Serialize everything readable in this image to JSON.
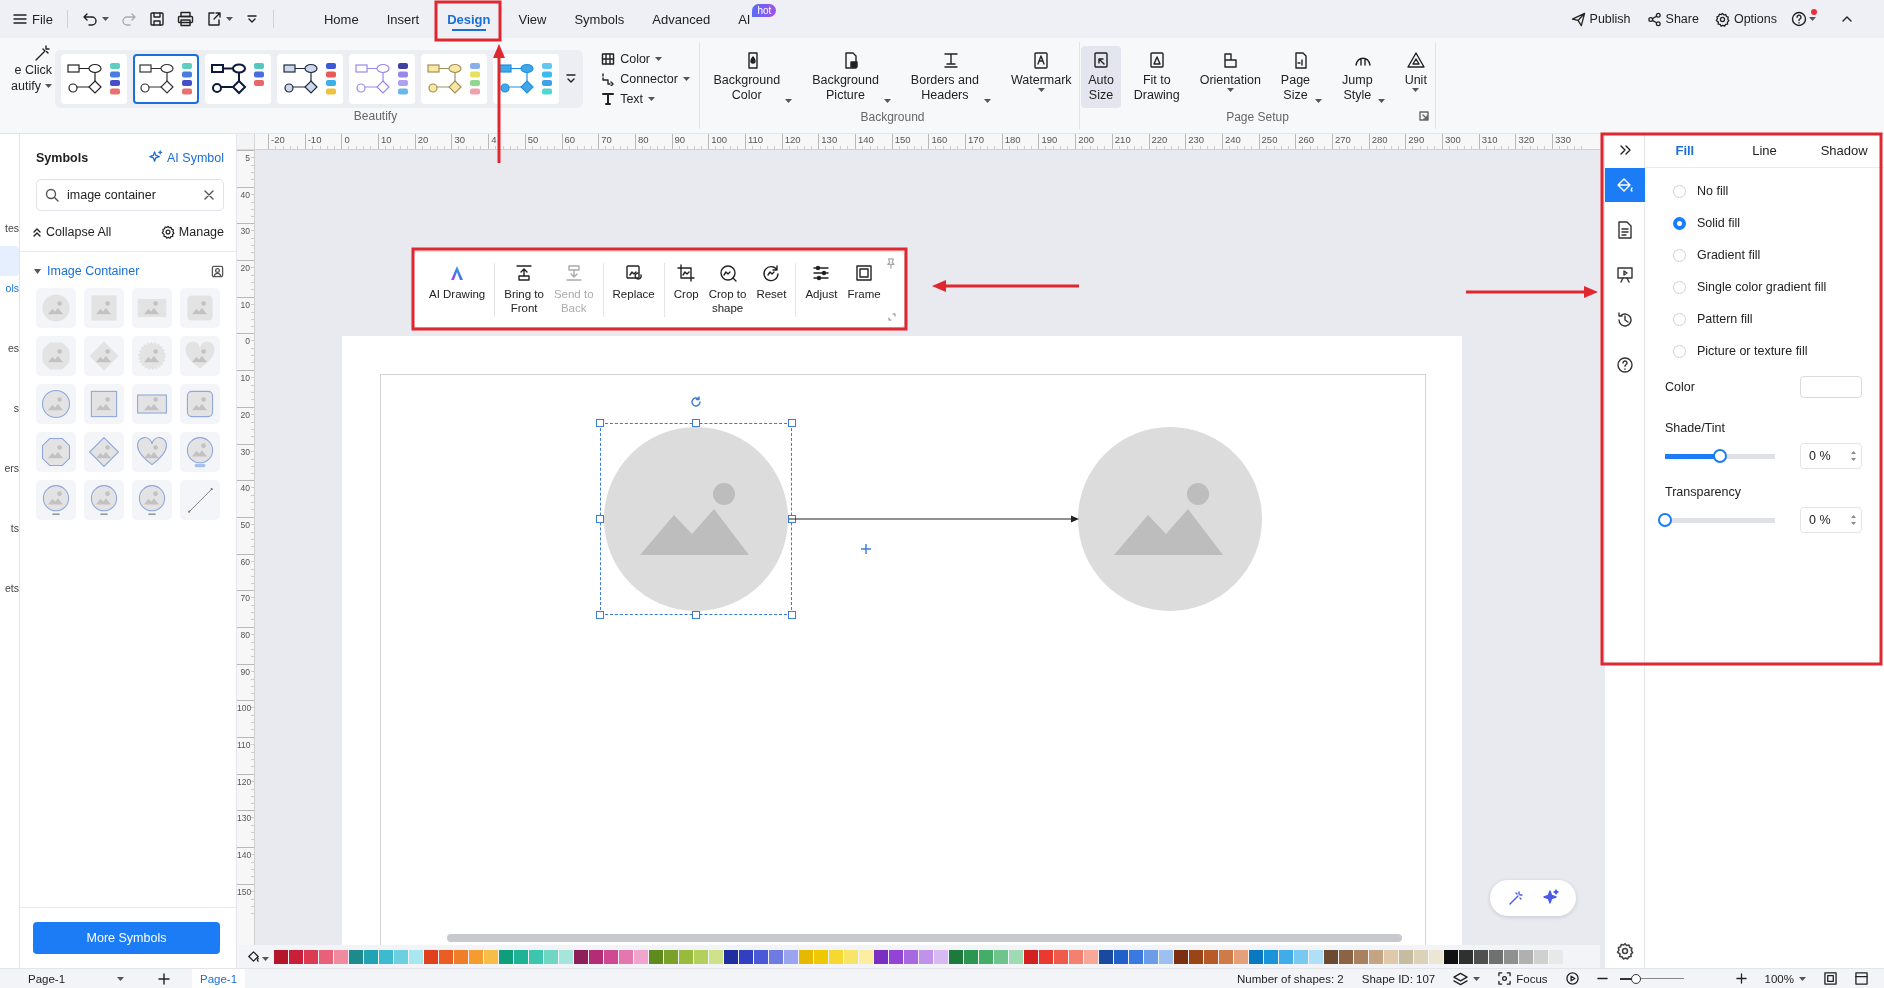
{
  "topbar": {
    "file": "File",
    "tabs": [
      {
        "label": "Home",
        "selected": false
      },
      {
        "label": "Insert",
        "selected": false
      },
      {
        "label": "Design",
        "selected": true
      },
      {
        "label": "View",
        "selected": false
      },
      {
        "label": "Symbols",
        "selected": false
      },
      {
        "label": "Advanced",
        "selected": false
      },
      {
        "label": "AI",
        "selected": false,
        "badge": "hot"
      }
    ],
    "actions": [
      "Publish",
      "Share",
      "Options"
    ],
    "help_notification": true
  },
  "ribbon": {
    "beautify": {
      "label": [
        "e Click",
        "autify"
      ],
      "group": "Beautify",
      "styles": [
        {
          "selected": false
        },
        {
          "selected": true
        },
        {
          "selected": false
        },
        {
          "selected": false
        },
        {
          "selected": false
        },
        {
          "selected": false
        },
        {
          "selected": false
        }
      ]
    },
    "menus": [
      "Color",
      "Connector",
      "Text"
    ],
    "background": {
      "group": "Background",
      "buttons": [
        {
          "label": [
            "Background",
            "Color"
          ],
          "dropdown": true
        },
        {
          "label": [
            "Background",
            "Picture"
          ],
          "dropdown": true
        },
        {
          "label": [
            "Borders and",
            "Headers"
          ],
          "dropdown": true
        },
        {
          "label": [
            "Watermark"
          ],
          "dropdown": true
        }
      ]
    },
    "page_setup": {
      "group": "Page Setup",
      "buttons": [
        {
          "label": [
            "Auto",
            "Size"
          ],
          "dropdown": false,
          "active": true
        },
        {
          "label": [
            "Fit to",
            "Drawing"
          ],
          "dropdown": false,
          "active": false
        },
        {
          "label": [
            "Orientation"
          ],
          "dropdown": true,
          "active": false
        },
        {
          "label": [
            "Page",
            "Size"
          ],
          "dropdown": true,
          "active": false
        },
        {
          "label": [
            "Jump",
            "Style"
          ],
          "dropdown": true,
          "active": false
        },
        {
          "label": [
            "Unit"
          ],
          "dropdown": true,
          "active": false
        }
      ]
    }
  },
  "nav": [
    {
      "label": "tes",
      "selected": false
    },
    {
      "label": "ols",
      "selected": true
    },
    {
      "label": "es",
      "selected": false
    },
    {
      "label": "s",
      "selected": false
    },
    {
      "label": "ers",
      "selected": false
    },
    {
      "label": "ts",
      "selected": false
    },
    {
      "label": "ets",
      "selected": false
    }
  ],
  "symbols": {
    "title": "Symbols",
    "ai_symbol": "AI Symbol",
    "search": {
      "value": "image container"
    },
    "collapse_all": "Collapse All",
    "manage": "Manage",
    "category": {
      "label": "Image Container",
      "expanded": true,
      "items": [
        {
          "kind": "circle"
        },
        {
          "kind": "square"
        },
        {
          "kind": "wide"
        },
        {
          "kind": "rounded"
        },
        {
          "kind": "octagon"
        },
        {
          "kind": "diamond"
        },
        {
          "kind": "badge"
        },
        {
          "kind": "heart"
        },
        {
          "kind": "circle-outline"
        },
        {
          "kind": "square-outline"
        },
        {
          "kind": "wide-outline"
        },
        {
          "kind": "rounded-outline"
        },
        {
          "kind": "octagon-outline"
        },
        {
          "kind": "diamond-outline"
        },
        {
          "kind": "heart-outline"
        },
        {
          "kind": "bulb"
        },
        {
          "kind": "caption"
        },
        {
          "kind": "caption"
        },
        {
          "kind": "caption"
        },
        {
          "kind": "line"
        }
      ]
    },
    "more": "More Symbols"
  },
  "rulers": {
    "horizontal": [
      "-20",
      "-10",
      "0",
      "10",
      "20",
      "30",
      "4",
      "50",
      "60",
      "70",
      "80",
      "90",
      "100",
      "110",
      "120",
      "130",
      "140",
      "150",
      "160",
      "170",
      "180",
      "190",
      "200",
      "210",
      "220",
      "230",
      "240",
      "250",
      "260",
      "270",
      "280",
      "290",
      "300",
      "310",
      "320",
      "330"
    ],
    "vertical": [
      "5",
      "40",
      "30",
      "20",
      "10",
      "0",
      "10",
      "20",
      "30",
      "40",
      "50",
      "60",
      "70",
      "80",
      "90",
      "100",
      "110",
      "120",
      "130",
      "140",
      "150"
    ]
  },
  "canvas": {
    "toolbar": {
      "groups": [
        [
          {
            "label": [
              "AI Drawing"
            ],
            "disabled": false
          }
        ],
        [
          {
            "label": [
              "Bring to",
              "Front"
            ],
            "disabled": false
          },
          {
            "label": [
              "Send to",
              "Back"
            ],
            "disabled": true
          }
        ],
        [
          {
            "label": [
              "Replace"
            ],
            "disabled": false
          }
        ],
        [
          {
            "label": [
              "Crop"
            ],
            "disabled": false
          },
          {
            "label": [
              "Crop to",
              "shape"
            ],
            "disabled": false
          },
          {
            "label": [
              "Reset"
            ],
            "disabled": false
          }
        ],
        [
          {
            "label": [
              "Adjust"
            ],
            "disabled": false
          },
          {
            "label": [
              "Frame"
            ],
            "disabled": false
          }
        ]
      ]
    },
    "shapes": [
      {
        "kind": "image-container",
        "selected": true
      },
      {
        "kind": "image-container",
        "selected": false
      }
    ]
  },
  "palette": [
    {
      "color": "#b5152b"
    },
    {
      "color": "#c8203a"
    },
    {
      "color": "#dc3a52"
    },
    {
      "color": "#e8607a"
    },
    {
      "color": "#f08aa0"
    },
    {
      "color": "#1d8a8e"
    },
    {
      "color": "#22a3b4"
    },
    {
      "color": "#3cbad0"
    },
    {
      "color": "#6dd0e0"
    },
    {
      "color": "#a8e6f0"
    },
    {
      "color": "#e0401e"
    },
    {
      "color": "#ea5e24"
    },
    {
      "color": "#f07e28"
    },
    {
      "color": "#f59c30"
    },
    {
      "color": "#f8bd48"
    },
    {
      "color": "#0e9f7a"
    },
    {
      "color": "#1fb396"
    },
    {
      "color": "#3cc6ad"
    },
    {
      "color": "#70d6c4"
    },
    {
      "color": "#a6e6da"
    },
    {
      "color": "#8e1f5a"
    },
    {
      "color": "#b22d75"
    },
    {
      "color": "#d04892"
    },
    {
      "color": "#e477b0"
    },
    {
      "color": "#f0a6cc"
    },
    {
      "color": "#5f8a1e"
    },
    {
      "color": "#7aa22a"
    },
    {
      "color": "#98bb3c"
    },
    {
      "color": "#b4d05c"
    },
    {
      "color": "#cfe28a"
    },
    {
      "color": "#1f2fa0"
    },
    {
      "color": "#3040c0"
    },
    {
      "color": "#4a5ad6"
    },
    {
      "color": "#6e7ce2"
    },
    {
      "color": "#9aa4ee"
    },
    {
      "color": "#e6b800"
    },
    {
      "color": "#f0c800"
    },
    {
      "color": "#f5d830"
    },
    {
      "color": "#f8e468"
    },
    {
      "color": "#fbeea0"
    },
    {
      "color": "#7a2fc0"
    },
    {
      "color": "#9244d4"
    },
    {
      "color": "#a868e0"
    },
    {
      "color": "#c092ea"
    },
    {
      "color": "#d8baf2"
    },
    {
      "color": "#1e7a3c"
    },
    {
      "color": "#2a9650"
    },
    {
      "color": "#44ae68"
    },
    {
      "color": "#6ec48c"
    },
    {
      "color": "#9edab2"
    },
    {
      "color": "#d42020"
    },
    {
      "color": "#e83a30"
    },
    {
      "color": "#f05a4a"
    },
    {
      "color": "#f48070"
    },
    {
      "color": "#f8a898"
    },
    {
      "color": "#1a4aa0"
    },
    {
      "color": "#2060c8"
    },
    {
      "color": "#3a7ae0"
    },
    {
      "color": "#6a9ce8"
    },
    {
      "color": "#9cc0f0"
    },
    {
      "color": "#7a3010"
    },
    {
      "color": "#9a4418"
    },
    {
      "color": "#b85a28"
    },
    {
      "color": "#d07a48"
    },
    {
      "color": "#e4a078"
    },
    {
      "color": "#0a78c0"
    },
    {
      "color": "#1a94d8"
    },
    {
      "color": "#40ace8"
    },
    {
      "color": "#78c8f0"
    },
    {
      "color": "#b0e0f8"
    },
    {
      "color": "#6a4a30"
    },
    {
      "color": "#8a6444"
    },
    {
      "color": "#a8825e"
    },
    {
      "color": "#c4a482"
    },
    {
      "color": "#e0c8aa"
    },
    {
      "color": "#c8bca0"
    },
    {
      "color": "#dcd2ba"
    },
    {
      "color": "#ece6d4"
    },
    {
      "color": "#101010"
    },
    {
      "color": "#303030"
    },
    {
      "color": "#505050"
    },
    {
      "color": "#707070"
    },
    {
      "color": "#909090"
    },
    {
      "color": "#b0b0b0"
    },
    {
      "color": "#d0d0d0"
    },
    {
      "color": "#e8e8e8"
    }
  ],
  "format_panel": {
    "side_tabs": [
      {
        "selected": true
      },
      {
        "selected": false
      },
      {
        "selected": false
      },
      {
        "selected": false
      },
      {
        "selected": false
      }
    ],
    "tabs": [
      {
        "label": "Fill",
        "selected": true
      },
      {
        "label": "Line",
        "selected": false
      },
      {
        "label": "Shadow",
        "selected": false
      }
    ],
    "fill_options": [
      {
        "label": "No fill",
        "selected": false
      },
      {
        "label": "Solid fill",
        "selected": true
      },
      {
        "label": "Gradient fill",
        "selected": false
      },
      {
        "label": "Single color gradient fill",
        "selected": false
      },
      {
        "label": "Pattern fill",
        "selected": false
      },
      {
        "label": "Picture or texture fill",
        "selected": false
      }
    ],
    "color": {
      "label": "Color",
      "color": "#ffffff"
    },
    "shade": {
      "label": "Shade/Tint",
      "level": 0.5,
      "value": "0 %"
    },
    "transparency": {
      "label": "Transparency",
      "level": 0,
      "value": "0 %"
    }
  },
  "status_bar": {
    "page_menu": "Page-1",
    "pages": [
      {
        "label": "Page-1",
        "selected": true
      }
    ],
    "shape_count": "Number of shapes: 2",
    "shape_id": "Shape ID: 107",
    "focus": "Focus",
    "zoom": {
      "level": 0.26,
      "value": "100%"
    }
  }
}
